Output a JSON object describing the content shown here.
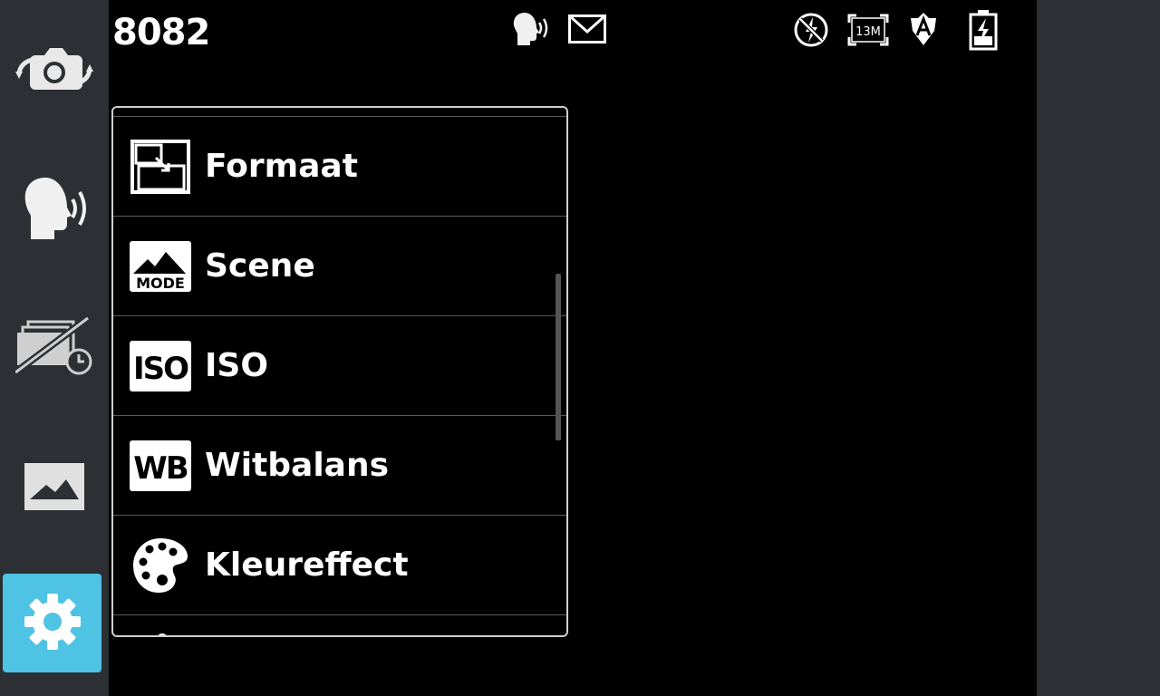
{
  "status": {
    "shot_count": "8082",
    "resolution_badge": "13M",
    "icons": [
      "voice-shutter-icon",
      "mail-icon",
      "flash-off-icon",
      "resolution-13m-icon",
      "auto-focus-icon",
      "battery-charging-icon"
    ]
  },
  "sidebar": {
    "items": [
      {
        "name": "switch-camera",
        "icon": "camera-swap-icon"
      },
      {
        "name": "voice-shutter",
        "icon": "speaking-head-icon"
      },
      {
        "name": "burst-timer",
        "icon": "timer-off-icon"
      },
      {
        "name": "gallery",
        "icon": "gallery-icon"
      },
      {
        "name": "settings",
        "icon": "gear-icon",
        "active": true
      }
    ]
  },
  "menu": {
    "items": [
      {
        "label": "Formaat",
        "icon": "image-size-icon"
      },
      {
        "label": "Scene",
        "icon": "scene-mode-icon",
        "badge": "MODE"
      },
      {
        "label": "ISO",
        "icon": "iso-icon",
        "badge": "ISO"
      },
      {
        "label": "Witbalans",
        "icon": "white-balance-icon",
        "badge": "WB"
      },
      {
        "label": "Kleureffect",
        "icon": "palette-icon"
      }
    ]
  },
  "colors": {
    "sidebar_bg": "#2c2f33",
    "active_accent": "#4fc3e3",
    "panel_border": "#cfcfcf"
  }
}
